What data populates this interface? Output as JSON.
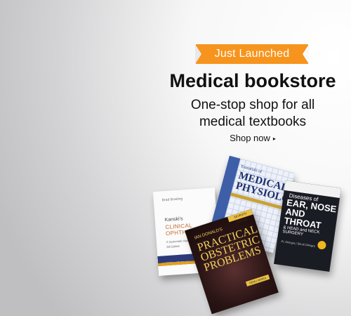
{
  "banner": {
    "ribbon_label": "Just Launched",
    "headline": "Medical bookstore",
    "subline": "One-stop shop for all medical textbooks",
    "cta_label": "Shop now",
    "cta_caret": "▸",
    "ribbon_color": "#f7941d"
  },
  "books": [
    {
      "author": "Brad Bowling",
      "title_line1": "Kanski's",
      "title_line2": "CLINICAL OPHTHALMOLOGY",
      "subtitle": "A Systematic Approach",
      "edition": "8th Edition",
      "band": "INTERNATIONAL"
    },
    {
      "title_line1": "Essentials of",
      "title_line2": "MEDICAL PHYSIOLOGY"
    },
    {
      "title_line1": "Diseases of",
      "title_line2": "EAR, NOSE AND THROAT",
      "title_line3": "& HEAD and NECK SURGERY",
      "authors": "PL Dhingra | Shruti Dhingra"
    },
    {
      "tag": "SEVENTH EDITION",
      "author": "IAN DONALD'S",
      "title": "PRACTICAL OBSTETRIC PROBLEMS",
      "edition_badge": "RENU MISRA"
    }
  ]
}
